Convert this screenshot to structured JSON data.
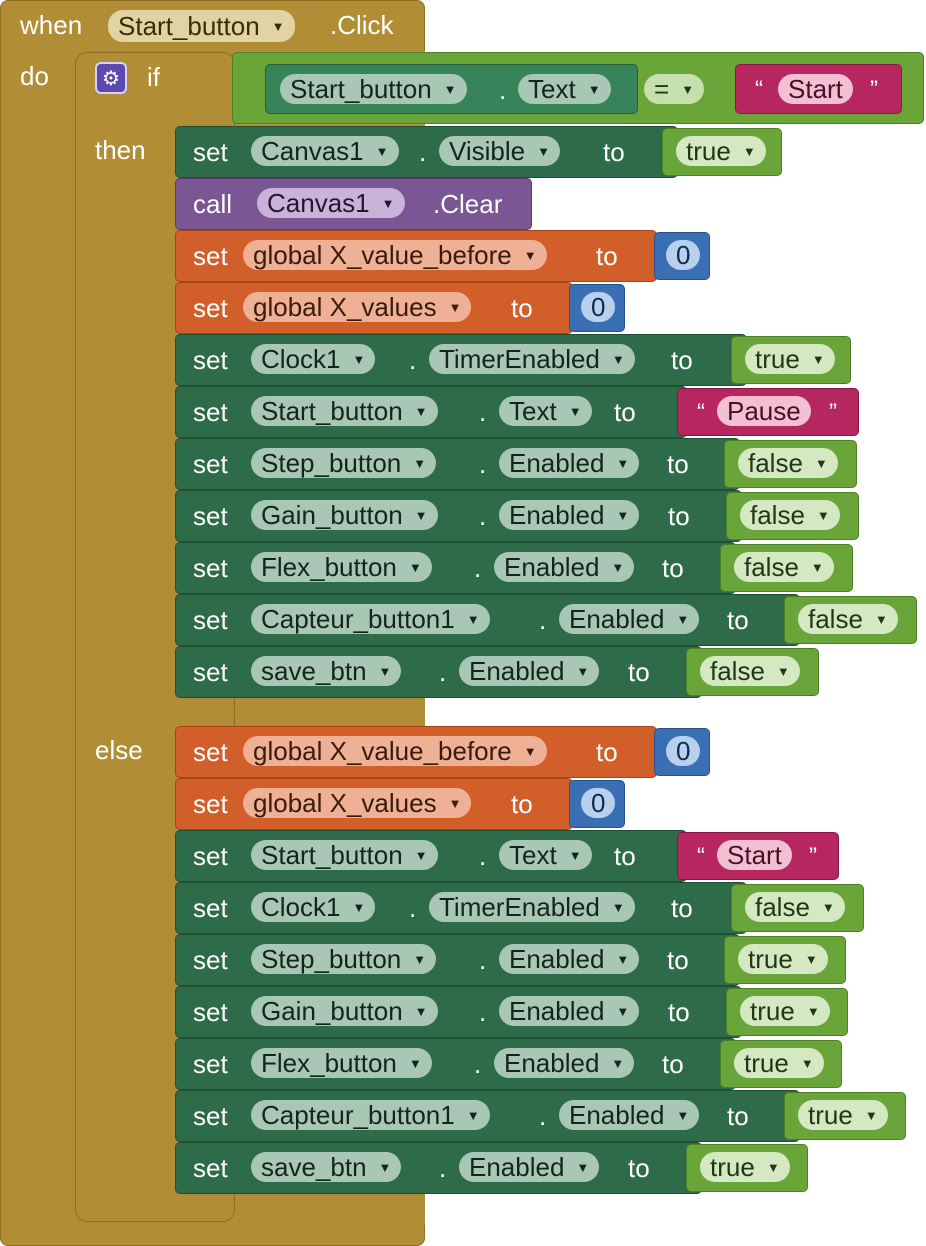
{
  "event": {
    "when": "when",
    "component": "Start_button",
    "event_name": ".Click",
    "do": "do"
  },
  "if_block": {
    "if": "if",
    "then": "then",
    "else": "else"
  },
  "condition": {
    "component": "Start_button",
    "dot": ".",
    "property": "Text",
    "operator": "=",
    "open_quote": "“",
    "value": "Start",
    "close_quote": "”"
  },
  "keywords": {
    "set": "set",
    "to": "to",
    "call": "call",
    "dot": "."
  },
  "then_blocks": [
    {
      "kind": "comp",
      "component": "Canvas1",
      "property": "Visible",
      "value_kind": "bool",
      "value": "true"
    },
    {
      "kind": "call",
      "component": "Canvas1",
      "method": ".Clear"
    },
    {
      "kind": "var",
      "variable": "global X_value_before",
      "value_kind": "num",
      "value": "0"
    },
    {
      "kind": "var",
      "variable": "global X_values",
      "value_kind": "num",
      "value": "0"
    },
    {
      "kind": "comp",
      "component": "Clock1",
      "property": "TimerEnabled",
      "value_kind": "bool",
      "value": "true"
    },
    {
      "kind": "comp",
      "component": "Start_button",
      "property": "Text",
      "value_kind": "text",
      "value": "Pause"
    },
    {
      "kind": "comp",
      "component": "Step_button",
      "property": "Enabled",
      "value_kind": "bool",
      "value": "false"
    },
    {
      "kind": "comp",
      "component": "Gain_button",
      "property": "Enabled",
      "value_kind": "bool",
      "value": "false"
    },
    {
      "kind": "comp",
      "component": "Flex_button",
      "property": "Enabled",
      "value_kind": "bool",
      "value": "false"
    },
    {
      "kind": "comp",
      "component": "Capteur_button1",
      "property": "Enabled",
      "value_kind": "bool",
      "value": "false"
    },
    {
      "kind": "comp",
      "component": "save_btn",
      "property": "Enabled",
      "value_kind": "bool",
      "value": "false"
    }
  ],
  "else_blocks": [
    {
      "kind": "var",
      "variable": "global X_value_before",
      "value_kind": "num",
      "value": "0"
    },
    {
      "kind": "var",
      "variable": "global X_values",
      "value_kind": "num",
      "value": "0"
    },
    {
      "kind": "comp",
      "component": "Start_button",
      "property": "Text",
      "value_kind": "text",
      "value": "Start"
    },
    {
      "kind": "comp",
      "component": "Clock1",
      "property": "TimerEnabled",
      "value_kind": "bool",
      "value": "false"
    },
    {
      "kind": "comp",
      "component": "Step_button",
      "property": "Enabled",
      "value_kind": "bool",
      "value": "true"
    },
    {
      "kind": "comp",
      "component": "Gain_button",
      "property": "Enabled",
      "value_kind": "bool",
      "value": "true"
    },
    {
      "kind": "comp",
      "component": "Flex_button",
      "property": "Enabled",
      "value_kind": "bool",
      "value": "true"
    },
    {
      "kind": "comp",
      "component": "Capteur_button1",
      "property": "Enabled",
      "value_kind": "bool",
      "value": "true"
    },
    {
      "kind": "comp",
      "component": "save_btn",
      "property": "Enabled",
      "value_kind": "bool",
      "value": "true"
    }
  ],
  "colors": {
    "event": "#b18e35",
    "component_set": "#2e6b48",
    "variable_set": "#d25f2a",
    "call": "#7b5694",
    "logic": "#6aa53a",
    "text": "#b5275e",
    "math": "#3a6fb3"
  },
  "icons": {
    "mutator": "gear-icon",
    "dropdown": "dropdown-arrow-icon"
  }
}
